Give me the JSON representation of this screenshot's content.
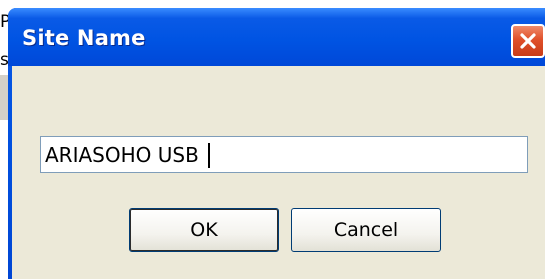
{
  "background": {
    "line1": "PE",
    "line2": "s"
  },
  "dialog": {
    "title": "Site Name",
    "close_icon": "close-icon",
    "input": {
      "value": "ARIASOHO USB"
    },
    "buttons": {
      "ok": "OK",
      "cancel": "Cancel"
    }
  },
  "colors": {
    "titlebar": "#0054e3",
    "client": "#ece9d8",
    "close_button": "#e0502a"
  }
}
